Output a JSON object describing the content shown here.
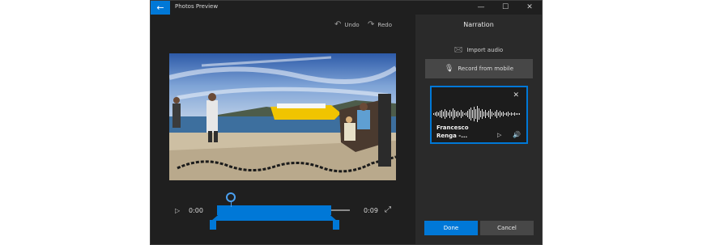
{
  "window": {
    "title": "Photos Preview",
    "back_icon": "arrow-left-icon",
    "controls": {
      "minimize": "—",
      "maximize": "☐",
      "close": "✕"
    }
  },
  "toolbar": {
    "undo_label": "Undo",
    "redo_label": "Redo",
    "undo_icon": "↶",
    "redo_icon": "↷"
  },
  "timeline": {
    "current_time": "0:00",
    "duration": "0:09",
    "play_icon": "▷",
    "expand_icon": "⤢"
  },
  "panel": {
    "title": "Narration",
    "import_label": "Import audio",
    "import_icon": "🖂",
    "record_label": "Record from mobile",
    "record_icon": "mic-icon",
    "audio_card": {
      "artist": "Francesco Renga -...",
      "play_icon": "▷",
      "volume_icon": "🔊",
      "close_icon": "✕"
    },
    "done_label": "Done",
    "cancel_label": "Cancel"
  },
  "colors": {
    "accent": "#0078d7",
    "window_bg": "#1f1f1f",
    "panel_bg": "#2a2a2a",
    "button_bg": "#474747"
  }
}
